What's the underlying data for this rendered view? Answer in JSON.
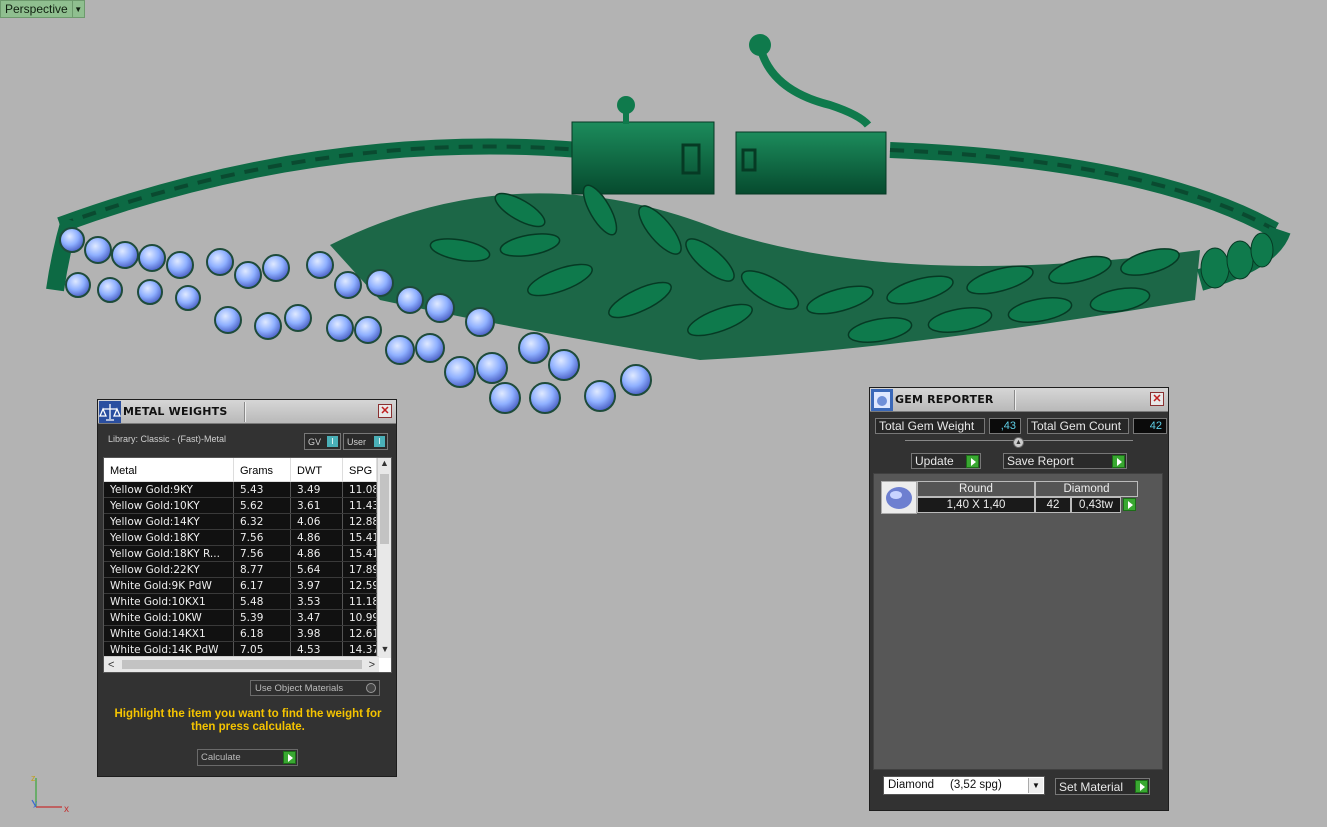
{
  "viewport": {
    "label": "Perspective"
  },
  "metal_weights": {
    "title": "METAL WEIGHTS",
    "library": "Library: Classic - (Fast)-Metal",
    "gv_label": "GV",
    "user_label": "User",
    "columns": [
      "Metal",
      "Grams",
      "DWT",
      "SPG"
    ],
    "rows": [
      [
        "Yellow Gold:9KY",
        "5.43",
        "3.49",
        "11.08"
      ],
      [
        "Yellow Gold:10KY",
        "5.62",
        "3.61",
        "11.43"
      ],
      [
        "Yellow Gold:14KY",
        "6.32",
        "4.06",
        "12.88"
      ],
      [
        "Yellow Gold:18KY",
        "7.56",
        "4.86",
        "15.41"
      ],
      [
        "Yellow Gold:18KY R...",
        "7.56",
        "4.86",
        "15.41"
      ],
      [
        "Yellow Gold:22KY",
        "8.77",
        "5.64",
        "17.89"
      ],
      [
        "White Gold:9K PdW",
        "6.17",
        "3.97",
        "12.59"
      ],
      [
        "White Gold:10KX1",
        "5.48",
        "3.53",
        "11.18"
      ],
      [
        "White Gold:10KW",
        "5.39",
        "3.47",
        "10.99"
      ],
      [
        "White Gold:14KX1",
        "6.18",
        "3.98",
        "12.61"
      ],
      [
        "White Gold:14K PdW",
        "7.05",
        "4.53",
        "14.37"
      ]
    ],
    "use_object_materials": "Use Object Materials",
    "hint": "Highlight the item you want to find the weight for then press calculate.",
    "calculate_label": "Calculate"
  },
  "gem_reporter": {
    "title": "GEM REPORTER",
    "total_weight_label": "Total Gem Weight",
    "total_weight_value": ",43",
    "total_count_label": "Total Gem Count",
    "total_count_value": "42",
    "update_label": "Update",
    "save_report_label": "Save Report",
    "gem": {
      "shape": "Round",
      "material": "Diamond",
      "size": "1,40 X 1,40",
      "count": "42",
      "weight": "0,43tw"
    },
    "material_select": "Diamond     (3,52 spg)",
    "set_material_label": "Set Material"
  },
  "colors": {
    "background": "#b3b3b3",
    "metal": "#0e6b45",
    "gem": "#8fb4ff",
    "accent_green": "#39a831",
    "hint_yellow": "#f5c400"
  }
}
